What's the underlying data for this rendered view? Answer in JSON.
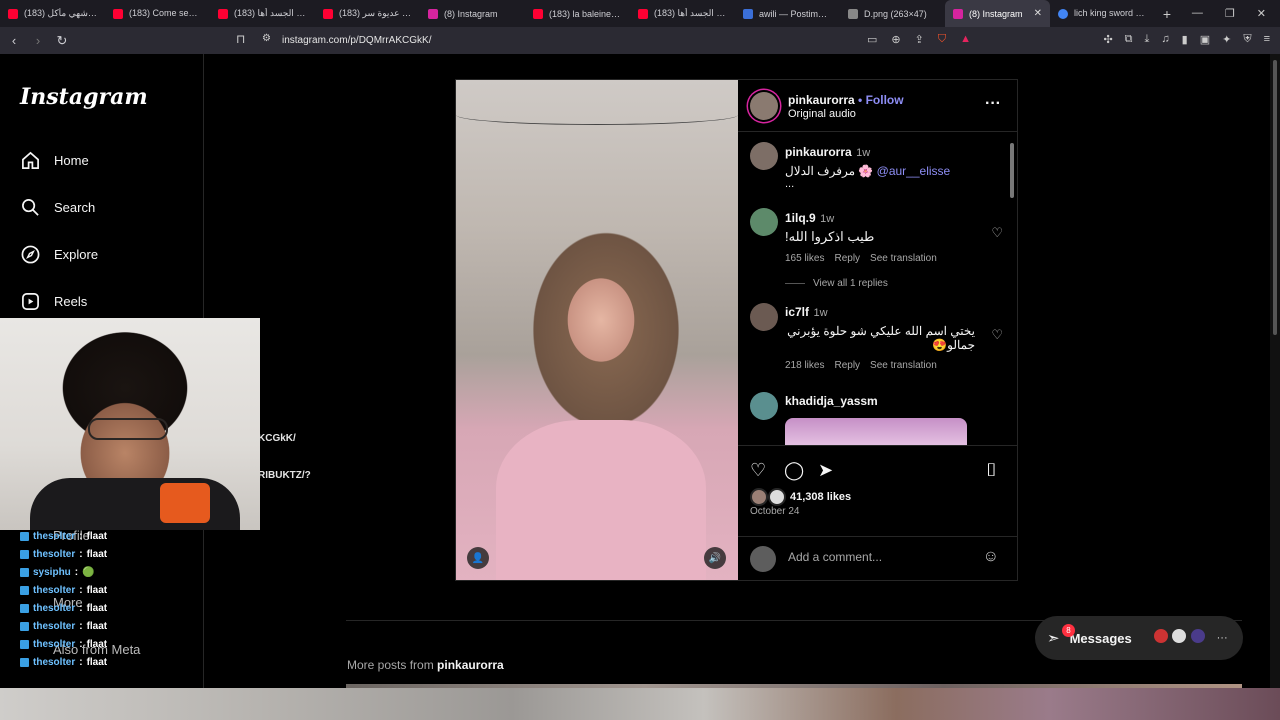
{
  "browser": {
    "tabs": [
      {
        "label": "(183) أشهي مأكل 🌟",
        "fav": "#ff0033"
      },
      {
        "label": "(183) Come see 😂",
        "fav": "#ff0033"
      },
      {
        "label": "(183) واش الجسد أها",
        "fav": "#ff0033"
      },
      {
        "label": "(183) عديوة سر 📼",
        "fav": "#ff0033"
      },
      {
        "label": "(8) Instagram",
        "fav": "#d6249f"
      },
      {
        "label": "(183) la baleine ana",
        "fav": "#ff0033"
      },
      {
        "label": "(183) واش الجسد أها",
        "fav": "#ff0033"
      },
      {
        "label": "awili — Postimages",
        "fav": "#3b6fd8"
      },
      {
        "label": "D.png (263×47)",
        "fav": "#888888"
      },
      {
        "label": "(8) Instagram",
        "fav": "#d6249f"
      },
      {
        "label": "lich king sword - ↻",
        "fav": "#4285f4"
      }
    ],
    "active_tab_index": 9,
    "new_tab": "+",
    "url": "instagram.com/p/DQMrrAKCGkK/"
  },
  "sidebar": {
    "logo": "Instagram",
    "items": [
      {
        "label": "Home",
        "icon": "home-icon"
      },
      {
        "label": "Search",
        "icon": "search-icon"
      },
      {
        "label": "Explore",
        "icon": "compass-icon"
      },
      {
        "label": "Reels",
        "icon": "reels-icon"
      }
    ],
    "profile": "Profile",
    "more": "More",
    "also_from_meta": "Also from Meta"
  },
  "post": {
    "author": "pinkaurorra",
    "follow": "Follow",
    "audio": "Original audio",
    "caption_user": "pinkaurorra",
    "caption_time": "1w",
    "caption_text": "مرفرف الدلال 🌸",
    "caption_mention": "@aur__elisse",
    "caption_more": "...",
    "comments": [
      {
        "user": "1ilq.9",
        "time": "1w",
        "text": "طيب اذكروا الله!",
        "likes": "165 likes",
        "reply": "Reply",
        "translate": "See translation",
        "view_replies": "View all 1 replies"
      },
      {
        "user": "ic7lf",
        "time": "1w",
        "text": "يختي اسم الله عليكي شو حلوة يؤبرني جمالو😍",
        "likes": "218 likes",
        "reply": "Reply",
        "translate": "See translation"
      },
      {
        "user": "khadidja_yassm"
      }
    ],
    "likes": "41,308 likes",
    "date": "October 24",
    "add_comment_placeholder": "Add a comment...",
    "more_posts_prefix": "More posts from",
    "more_posts_user": "pinkaurorra"
  },
  "messages": {
    "label": "Messages",
    "badge": "8"
  },
  "stream": {
    "leaked_url_1": "KCGkK/",
    "leaked_url_2": "RIBUKTZ/?",
    "chat": [
      {
        "user": "thesolter",
        "msg": "flaat"
      },
      {
        "user": "thesolter",
        "msg": "flaat"
      },
      {
        "user": "sysiphu",
        "msg": "🟢"
      },
      {
        "user": "thesolter",
        "msg": "flaat"
      },
      {
        "user": "thesolter",
        "msg": "flaat"
      },
      {
        "user": "thesolter",
        "msg": "flaat"
      },
      {
        "user": "thesolter",
        "msg": "flaat"
      },
      {
        "user": "thesolter",
        "msg": "flaat"
      }
    ]
  }
}
